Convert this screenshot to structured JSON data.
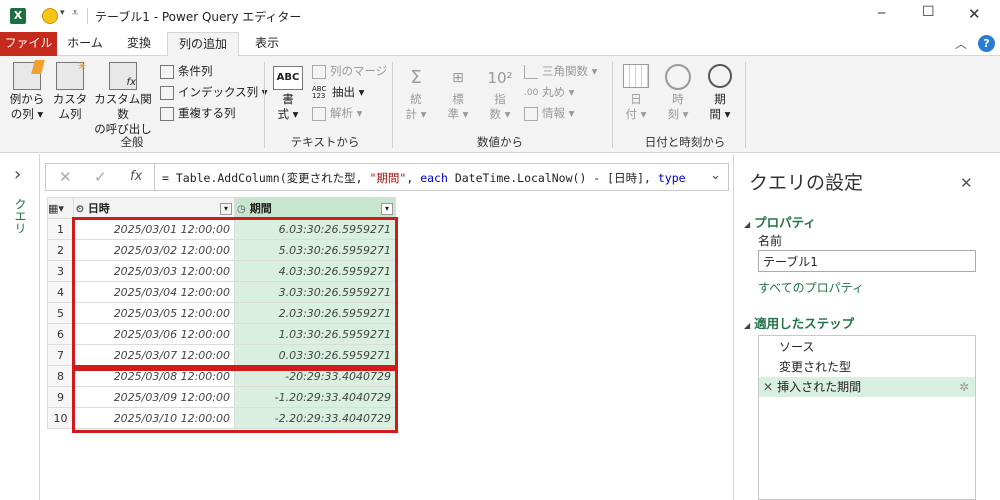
{
  "titlebar": {
    "title": "テーブル1 - Power Query エディター",
    "minimize": "─",
    "maximize": "☐",
    "close": "✕"
  },
  "tabs": [
    "ファイル",
    "ホーム",
    "変換",
    "列の追加",
    "表示"
  ],
  "ribbon": {
    "groups": {
      "general": "全般",
      "text": "テキストから",
      "number": "数値から",
      "datetime": "日付と時刻から"
    },
    "example_column": [
      "例から",
      "の列 ▾"
    ],
    "custom_column": [
      "カスタ",
      "ム列"
    ],
    "invoke_custom_function": [
      "カスタム関数",
      "の呼び出し"
    ],
    "conditional_column": "条件列",
    "index_column": "インデックス列 ▾",
    "duplicate_column": "重複する列",
    "format": [
      "書",
      "式 ▾"
    ],
    "merge_columns": "列のマージ",
    "extract": "抽出 ▾",
    "parse": "解析 ▾",
    "statistics": [
      "統",
      "計 ▾"
    ],
    "standard": [
      "標",
      "準 ▾"
    ],
    "scientific": [
      "指",
      "数 ▾"
    ],
    "trigonometry": "三角関数 ▾",
    "rounding": "丸め ▾",
    "information": "情報 ▾",
    "date": [
      "日",
      "付 ▾"
    ],
    "time": [
      "時",
      "刻 ▾"
    ],
    "duration": [
      "期",
      "間 ▾"
    ]
  },
  "left_pane": {
    "label": "クエリ",
    "expand": "›"
  },
  "formula_bar": {
    "cancel": "✕",
    "commit": "✓",
    "fx": "fx",
    "text_parts": [
      "= Table.AddColumn(変更された型, ",
      "\"期間\"",
      ", ",
      "each",
      " DateTime.LocalNow() - [日時], ",
      "type"
    ]
  },
  "table": {
    "columns": [
      {
        "name": "日時",
        "type_icon": "datetime-type-icon"
      },
      {
        "name": "期間",
        "type_icon": "duration-type-icon"
      }
    ],
    "rows": [
      {
        "n": "1",
        "dt": "2025/03/01 12:00:00",
        "d": "6.03:30:26.5959271"
      },
      {
        "n": "2",
        "dt": "2025/03/02 12:00:00",
        "d": "5.03:30:26.5959271"
      },
      {
        "n": "3",
        "dt": "2025/03/03 12:00:00",
        "d": "4.03:30:26.5959271"
      },
      {
        "n": "4",
        "dt": "2025/03/04 12:00:00",
        "d": "3.03:30:26.5959271"
      },
      {
        "n": "5",
        "dt": "2025/03/05 12:00:00",
        "d": "2.03:30:26.5959271"
      },
      {
        "n": "6",
        "dt": "2025/03/06 12:00:00",
        "d": "1.03:30:26.5959271"
      },
      {
        "n": "7",
        "dt": "2025/03/07 12:00:00",
        "d": "0.03:30:26.5959271"
      },
      {
        "n": "8",
        "dt": "2025/03/08 12:00:00",
        "d": "-20:29:33.4040729"
      },
      {
        "n": "9",
        "dt": "2025/03/09 12:00:00",
        "d": "-1.20:29:33.4040729"
      },
      {
        "n": "10",
        "dt": "2025/03/10 12:00:00",
        "d": "-2.20:29:33.4040729"
      }
    ]
  },
  "query_settings": {
    "title": "クエリの設定",
    "close": "✕",
    "properties_header": "プロパティ",
    "name_label": "名前",
    "name_value": "テーブル1",
    "all_properties_link": "すべてのプロパティ",
    "applied_steps_header": "適用したステップ",
    "steps": [
      "ソース",
      "変更された型",
      "挿入された期間"
    ]
  },
  "colors": {
    "file_tab": "#c42b1c",
    "accent_green": "#217346",
    "selected_column": "#d9efe0",
    "highlight_red": "#d11a1a"
  }
}
